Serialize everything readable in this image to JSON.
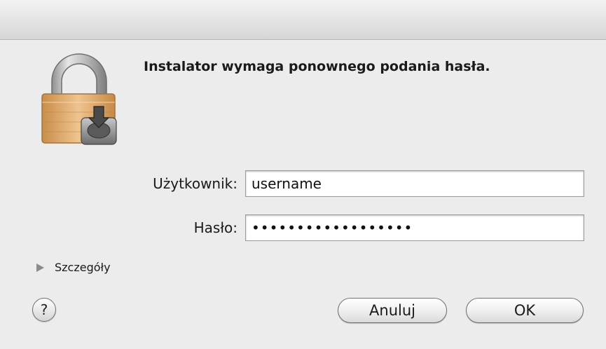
{
  "dialog": {
    "message": "Instalator wymaga ponownego podania hasła.",
    "icon": "lock-installer-icon"
  },
  "form": {
    "username_label": "Użytkownik:",
    "username_value": "username",
    "password_label": "Hasło:",
    "password_value": "••••••••••••••••••"
  },
  "details": {
    "label": "Szczegóły",
    "icon": "disclosure-triangle-icon"
  },
  "buttons": {
    "help_label": "?",
    "cancel_label": "Anuluj",
    "ok_label": "OK"
  },
  "colors": {
    "window_bg": "#ececec",
    "lock_body": "#e2b176",
    "lock_shackle": "#b5b5b5"
  }
}
